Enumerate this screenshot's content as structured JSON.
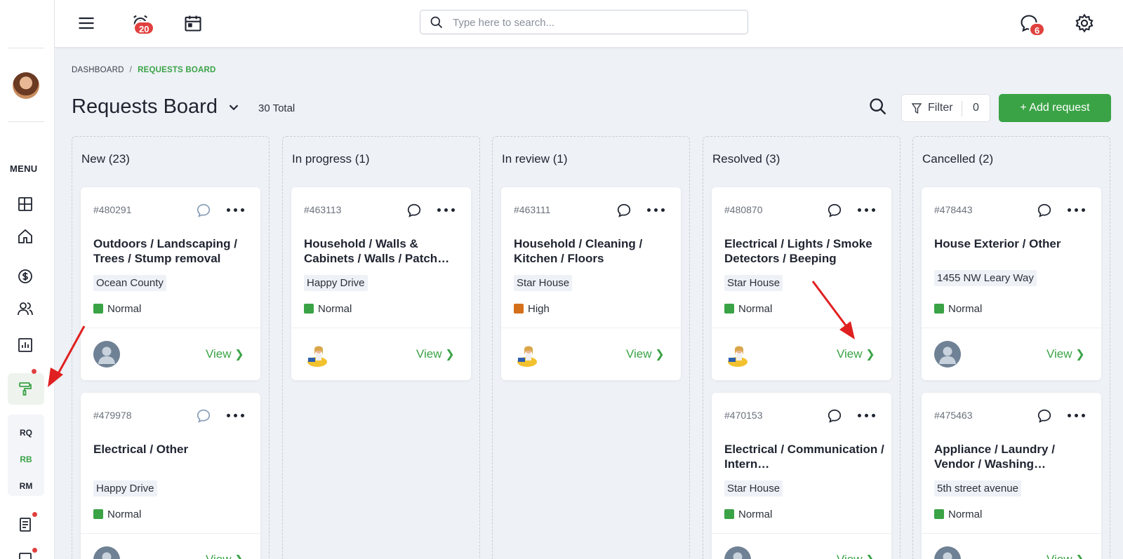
{
  "topbar": {
    "alarm_badge": "20",
    "chat_badge": "6",
    "search_placeholder": "Type here to search..."
  },
  "sidebar": {
    "menu_label": "MENU",
    "sub_items": [
      "RQ",
      "RB",
      "RM"
    ]
  },
  "breadcrumb": {
    "root": "DASHBOARD",
    "separator": "/",
    "current": "REQUESTS BOARD"
  },
  "header": {
    "title": "Requests Board",
    "total": "30 Total",
    "filter_label": "Filter",
    "filter_count": "0",
    "add_label": "+ Add request"
  },
  "colors": {
    "accent": "#3aa346",
    "priority_normal": "#3aa346",
    "priority_high": "#d4701c",
    "badge": "#e0413e"
  },
  "columns": [
    {
      "title": "New (23)",
      "cards": [
        {
          "id": "#480291",
          "title": "Outdoors / Landscaping / Trees / Stump removal",
          "location": "Ocean County",
          "priority": "Normal",
          "view": "View"
        },
        {
          "id": "#479978",
          "title": "Electrical / Other",
          "location": "Happy Drive",
          "priority": "Normal",
          "view": "View"
        }
      ]
    },
    {
      "title": "In progress (1)",
      "cards": [
        {
          "id": "#463113",
          "title": "Household / Walls & Cabinets / Walls / Patch…",
          "location": "Happy Drive",
          "priority": "Normal",
          "view": "View"
        }
      ]
    },
    {
      "title": "In review (1)",
      "cards": [
        {
          "id": "#463111",
          "title": "Household / Cleaning / Kitchen / Floors",
          "location": "Star House",
          "priority": "High",
          "view": "View"
        }
      ]
    },
    {
      "title": "Resolved (3)",
      "cards": [
        {
          "id": "#480870",
          "title": "Electrical / Lights / Smoke Detectors / Beeping",
          "location": "Star House",
          "priority": "Normal",
          "view": "View"
        },
        {
          "id": "#470153",
          "title": "Electrical / Communication / Intern…",
          "location": "Star House",
          "priority": "Normal",
          "view": "View"
        }
      ]
    },
    {
      "title": "Cancelled (2)",
      "cards": [
        {
          "id": "#478443",
          "title": "House Exterior / Other",
          "location": "1455 NW Leary Way",
          "priority": "Normal",
          "view": "View"
        },
        {
          "id": "#475463",
          "title": "Appliance / Laundry / Vendor / Washing…",
          "location": "5th street avenue",
          "priority": "Normal",
          "view": "View"
        }
      ]
    }
  ]
}
